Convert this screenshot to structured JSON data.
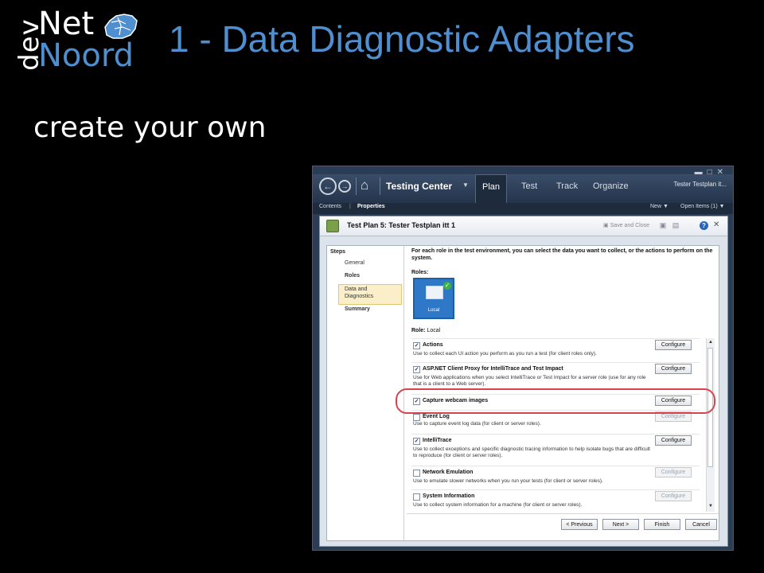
{
  "logo": {
    "dev": "dev",
    "net": "Net",
    "noord": "Noord"
  },
  "slide": {
    "title": "1 - Data Diagnostic Adapters",
    "subtitle": "create your own"
  },
  "window": {
    "app_title": "Testing Center",
    "tabs": [
      {
        "label": "Plan",
        "active": true
      },
      {
        "label": "Test",
        "active": false
      },
      {
        "label": "Track",
        "active": false
      },
      {
        "label": "Organize",
        "active": false
      }
    ],
    "top_right": "Tester Testplan it...",
    "subnav": {
      "contents": "Contents",
      "properties": "Properties"
    },
    "new_label": "New",
    "open_items": "Open Items (1)"
  },
  "panel": {
    "title": "Test Plan 5: Tester Testplan itt 1",
    "save_close": "Save and Close",
    "help": "?"
  },
  "steps": {
    "heading": "Steps",
    "items": [
      {
        "label": "General",
        "bold": false
      },
      {
        "label": "Roles",
        "bold": true
      },
      {
        "label": "Data and Diagnostics",
        "bold": false,
        "selected": true
      },
      {
        "label": "Summary",
        "bold": true
      }
    ]
  },
  "main": {
    "intro": "For each role in the test environment, you can select the data you want to collect, or the actions to perform on the system.",
    "roles_label": "Roles:",
    "role_tile": "Local",
    "role_line_label": "Role:",
    "role_line_value": "Local",
    "configure_label": "Configure",
    "adapters": [
      {
        "name": "Actions",
        "checked": true,
        "enabled": true,
        "desc": "Use to collect each UI action you perform as you run a test (for client roles only)."
      },
      {
        "name": "ASP.NET Client Proxy for IntelliTrace and Test Impact",
        "checked": true,
        "enabled": true,
        "desc": "Use for Web applications when you select IntelliTrace or Test Impact for a server role (use for any role that is a client to a Web server)."
      },
      {
        "name": "Capture webcam images",
        "checked": true,
        "enabled": true,
        "desc": ""
      },
      {
        "name": "Event Log",
        "checked": false,
        "enabled": false,
        "desc": "Use to capture event log data (for client or server roles)."
      },
      {
        "name": "IntelliTrace",
        "checked": true,
        "enabled": true,
        "desc": "Use to collect exceptions and specific diagnostic tracing information to help isolate bugs that are difficult to reproduce (for client or server roles)."
      },
      {
        "name": "Network Emulation",
        "checked": false,
        "enabled": false,
        "desc": "Use to emulate slower networks when you run your tests (for client or server roles)."
      },
      {
        "name": "System Information",
        "checked": false,
        "enabled": false,
        "desc": "Use to collect system information for a machine (for client or server roles)."
      }
    ]
  },
  "footer": {
    "previous": "< Previous",
    "next": "Next >",
    "finish": "Finish",
    "cancel": "Cancel"
  },
  "colors": {
    "title_blue": "#4f8fd0",
    "highlight_red": "#d9434f",
    "role_tile_blue": "#2f78c8"
  }
}
